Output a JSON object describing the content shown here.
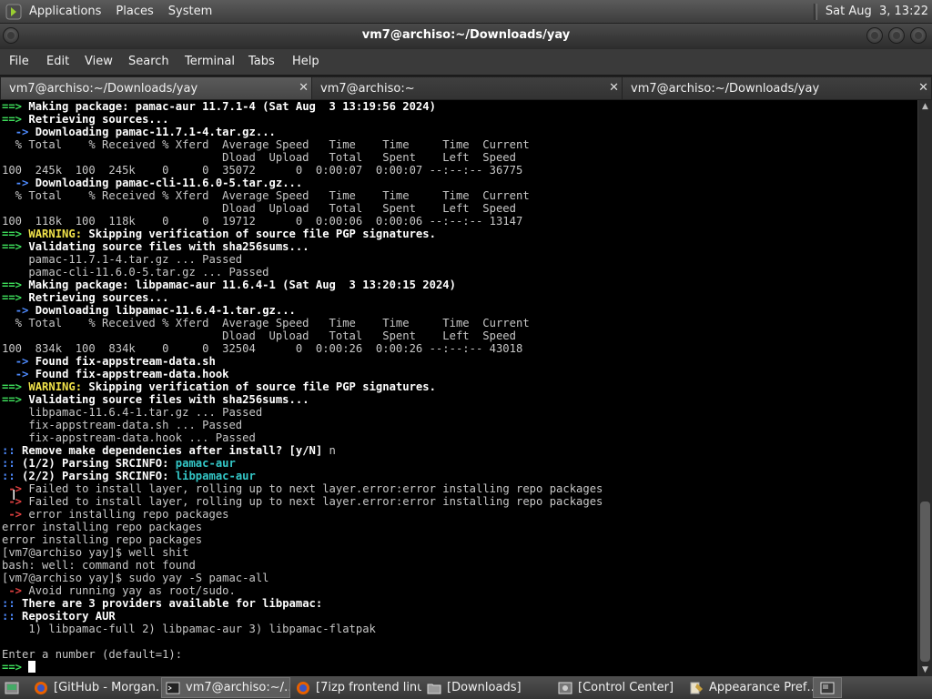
{
  "top_panel": {
    "menus": [
      "Applications",
      "Places",
      "System"
    ],
    "clock": "Sat Aug  3, 13:22"
  },
  "window": {
    "title": "vm7@archiso:~/Downloads/yay"
  },
  "menubar": [
    "File",
    "Edit",
    "View",
    "Search",
    "Terminal",
    "Tabs",
    "Help"
  ],
  "tabs": [
    {
      "label": "vm7@archiso:~/Downloads/yay",
      "active": true
    },
    {
      "label": "vm7@archiso:~",
      "active": false
    },
    {
      "label": "vm7@archiso:~/Downloads/yay",
      "active": false
    }
  ],
  "terminal": {
    "lines": [
      "==> Making package: pamac-aur 11.7.1-4 (Sat Aug  3 13:19:56 2024)",
      "==> Retrieving sources...",
      "  -> Downloading pamac-11.7.1-4.tar.gz...",
      "  % Total    % Received % Xferd  Average Speed   Time    Time     Time  Current",
      "                                 Dload  Upload   Total   Spent    Left  Speed",
      "100  245k  100  245k    0     0  35072      0  0:00:07  0:00:07 --:--:-- 36775",
      "  -> Downloading pamac-cli-11.6.0-5.tar.gz...",
      "  % Total    % Received % Xferd  Average Speed   Time    Time     Time  Current",
      "                                 Dload  Upload   Total   Spent    Left  Speed",
      "100  118k  100  118k    0     0  19712      0  0:00:06  0:00:06 --:--:-- 13147",
      "==> WARNING: Skipping verification of source file PGP signatures.",
      "==> Validating source files with sha256sums...",
      "    pamac-11.7.1-4.tar.gz ... Passed",
      "    pamac-cli-11.6.0-5.tar.gz ... Passed",
      "==> Making package: libpamac-aur 11.6.4-1 (Sat Aug  3 13:20:15 2024)",
      "==> Retrieving sources...",
      "  -> Downloading libpamac-11.6.4-1.tar.gz...",
      "  % Total    % Received % Xferd  Average Speed   Time    Time     Time  Current",
      "                                 Dload  Upload   Total   Spent    Left  Speed",
      "100  834k  100  834k    0     0  32504      0  0:00:26  0:00:26 --:--:-- 43018",
      "  -> Found fix-appstream-data.sh",
      "  -> Found fix-appstream-data.hook",
      "==> WARNING: Skipping verification of source file PGP signatures.",
      "==> Validating source files with sha256sums...",
      "    libpamac-11.6.4-1.tar.gz ... Passed",
      "    fix-appstream-data.sh ... Passed",
      "    fix-appstream-data.hook ... Passed",
      ":: Remove make dependencies after install? [y/N] n",
      ":: (1/2) Parsing SRCINFO: pamac-aur",
      ":: (2/2) Parsing SRCINFO: libpamac-aur",
      " -> Failed to install layer, rolling up to next layer.error:error installing repo packages",
      " -> Failed to install layer, rolling up to next layer.error:error installing repo packages",
      " -> error installing repo packages",
      "error installing repo packages",
      "error installing repo packages",
      "[vm7@archiso yay]$ well shit",
      "bash: well: command not found",
      "[vm7@archiso yay]$ sudo yay -S pamac-all",
      " -> Avoid running yay as root/sudo.",
      ":: There are 3 providers available for libpamac:",
      ":: Repository AUR",
      "    1) libpamac-full 2) libpamac-aur 3) libpamac-flatpak",
      "",
      "Enter a number (default=1):",
      "==> "
    ]
  },
  "taskbar": [
    {
      "label": "[GitHub - Morgan…",
      "icon": "firefox-icon",
      "active": false
    },
    {
      "label": "vm7@archiso:~/…",
      "icon": "terminal-icon",
      "active": true
    },
    {
      "label": "[7izp frontend linu…",
      "icon": "firefox-icon",
      "active": false
    },
    {
      "label": "[Downloads]",
      "icon": "folder-icon",
      "active": false
    },
    {
      "label": "[Control Center]",
      "icon": "control-center-icon",
      "active": false
    },
    {
      "label": "Appearance Pref…",
      "icon": "appearance-icon",
      "active": false
    }
  ],
  "colors": {
    "arrow_green": "#3ddc5a",
    "arrow_blue": "#4e8bff",
    "warning_yellow": "#f0e24a",
    "package_cyan": "#34c8c8",
    "error_red": "#e04040"
  }
}
